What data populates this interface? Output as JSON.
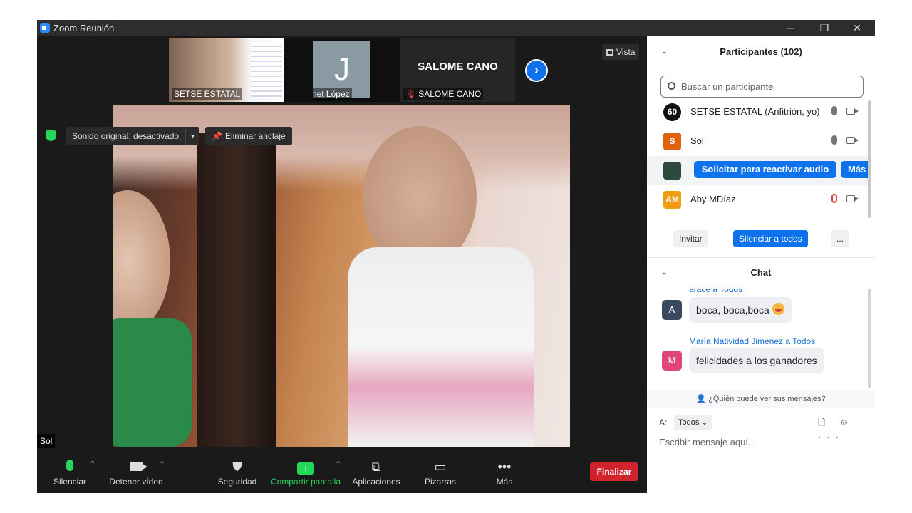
{
  "window": {
    "title": "Zoom Reunión",
    "controls": {
      "minimize": "─",
      "restore": "❐",
      "close": "✕"
    }
  },
  "top_strip": {
    "tiles": [
      {
        "name": "SETSE ESTATAL",
        "muted": false
      },
      {
        "name": "Janet López",
        "muted": true,
        "initial": "J"
      },
      {
        "name": "SALOME CANO",
        "muted": true,
        "display": "SALOME CANO"
      }
    ],
    "next_arrow": "›"
  },
  "vista_label": "Vista",
  "sonido_label": "Sonido original: desactivado",
  "dropdown_caret": "▾",
  "anclaje_label": "Eliminar anclaje",
  "pin_icon": "📌",
  "main_video_label": "Sol",
  "toolbar": {
    "silenciar": "Silenciar",
    "video": "Detener vídeo",
    "seguridad": "Seguridad",
    "compartir": "Compartir pantalla",
    "aplicaciones": "Aplicaciones",
    "pizarras": "Pizarras",
    "mas": "Más",
    "finalizar": "Finalizar",
    "caret": "⌃"
  },
  "participants": {
    "header": "Participantes (102)",
    "search_placeholder": "Buscar un participante",
    "rows": [
      {
        "avatar": "60",
        "name": "SETSE ESTATAL (Anfitrión, yo)",
        "color": "#111111"
      },
      {
        "avatar": "S",
        "name": "Sol",
        "color": "#e0620d"
      },
      {
        "avatar": "",
        "request_label": "Solicitar para reactivar audio",
        "more_label": "Más",
        "color": "#2e4a3c"
      },
      {
        "avatar": "AM",
        "name": "Aby MDíaz",
        "color": "#f39c12"
      }
    ],
    "invite": "Invitar",
    "mute_all": "Silenciar a todos",
    "more": "..."
  },
  "chat": {
    "header": "Chat",
    "messages": [
      {
        "sender": "arace a Todos",
        "avatar": "A",
        "avatar_color": "#3a4a5c",
        "text": "boca, boca,boca"
      },
      {
        "sender": "María Natividad Jiménez a Todos",
        "avatar": "M",
        "avatar_color": "#e0457b",
        "text": "felicidades a los ganadores"
      }
    ],
    "who_can_see": "¿Quién puede ver sus mensajes?",
    "to_label": "A:",
    "to_value": "Todos",
    "icons": "🗋 ☺ ···",
    "placeholder": "Escribir mensaje aquí..."
  },
  "chevron": "⌄"
}
